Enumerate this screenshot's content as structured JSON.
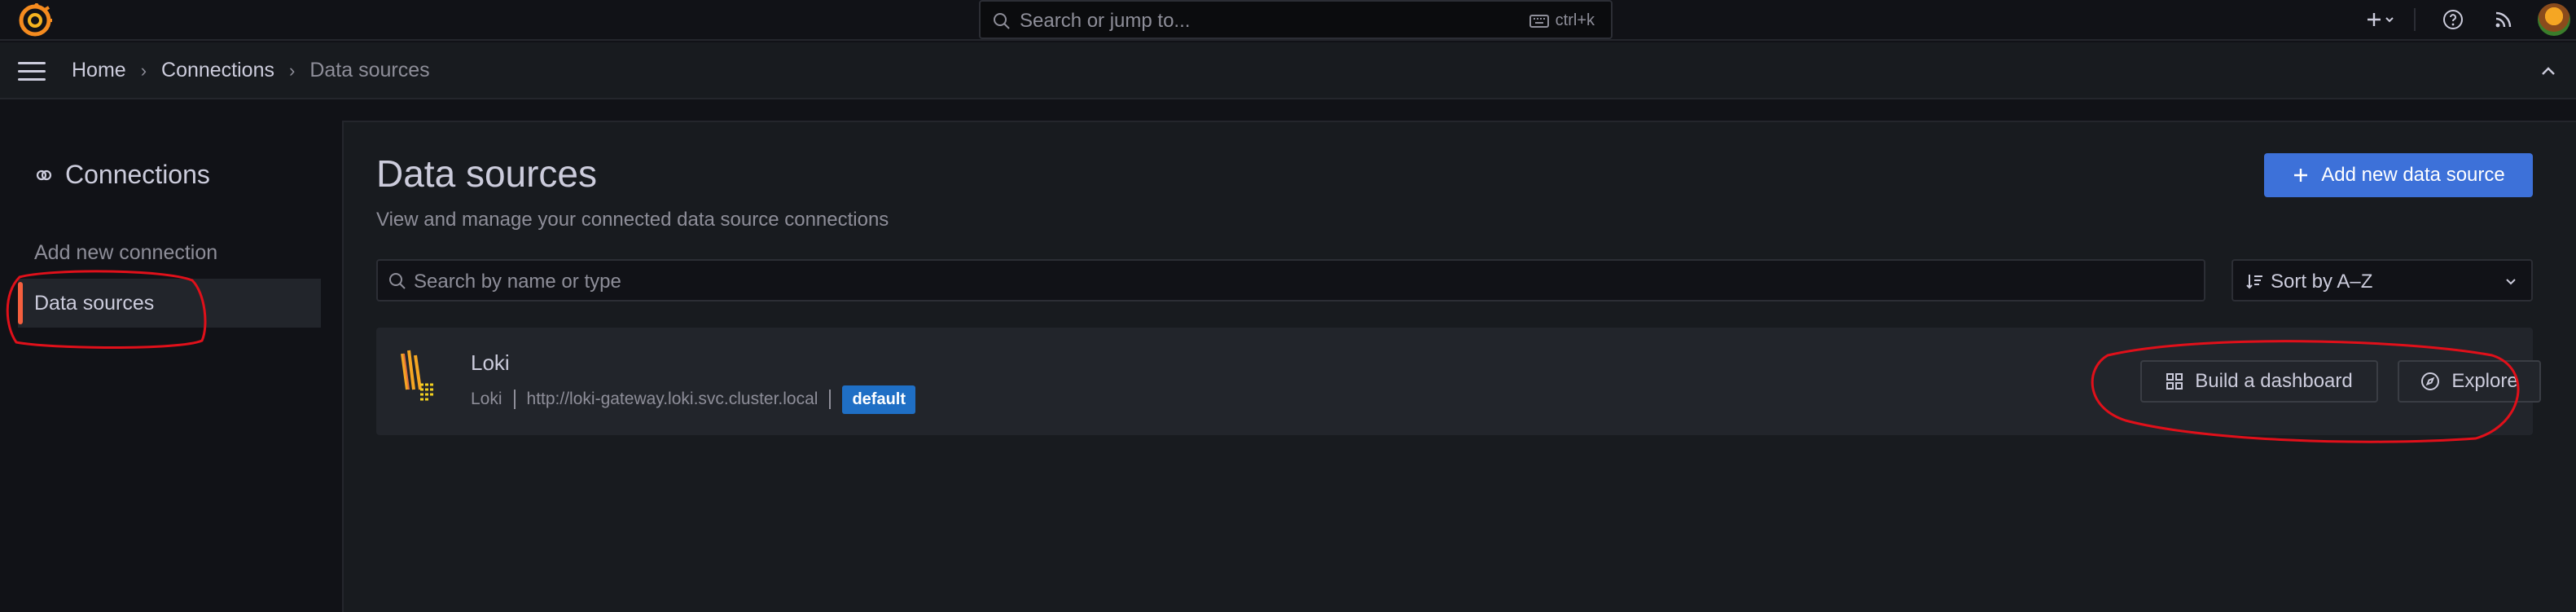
{
  "topbar": {
    "search_placeholder": "Search or jump to...",
    "shortcut": "ctrl+k",
    "icons": [
      "grafana-logo-icon",
      "plus-icon",
      "help-icon",
      "news-feed-icon",
      "user-avatar"
    ]
  },
  "breadcrumb": {
    "items": [
      "Home",
      "Connections",
      "Data sources"
    ]
  },
  "sidebar": {
    "title": "Connections",
    "items": [
      {
        "label": "Add new connection",
        "active": false
      },
      {
        "label": "Data sources",
        "active": true
      }
    ]
  },
  "main": {
    "title": "Data sources",
    "subtitle": "View and manage your connected data source connections",
    "add_button": "Add new data source",
    "filter_placeholder": "Search by name or type",
    "sort_label": "Sort by A–Z"
  },
  "datasource": {
    "name": "Loki",
    "type": "Loki",
    "url": "http://loki-gateway.loki.svc.cluster.local",
    "badge": "default",
    "build_button": "Build a dashboard",
    "explore_button": "Explore"
  },
  "colors": {
    "background": "#111217",
    "panel": "#181b1f",
    "card": "#22252b",
    "primary": "#3d71d9",
    "badge": "#1f6fc5",
    "accent_orange": "#f55f3e",
    "annotation_red": "#e0101a"
  }
}
